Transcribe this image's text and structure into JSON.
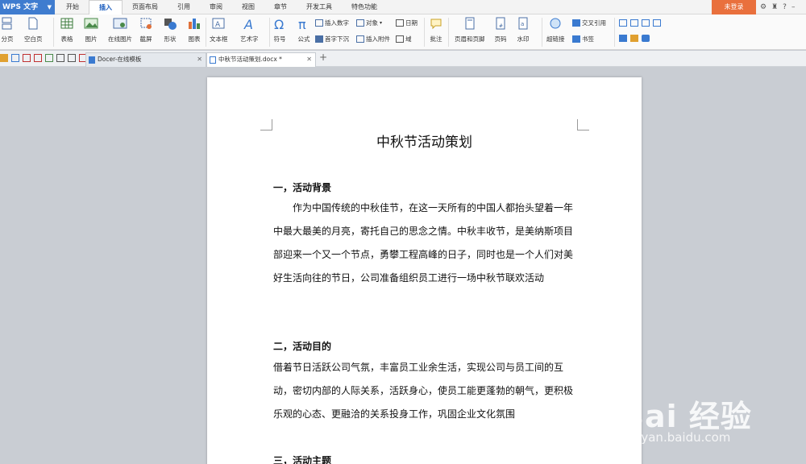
{
  "menubar": {
    "app_label": "WPS 文字",
    "tabs": [
      "开始",
      "插入",
      "页面布局",
      "引用",
      "审阅",
      "视图",
      "章节",
      "开发工具",
      "特色功能"
    ],
    "active_tab": "插入",
    "login_label": "未登录"
  },
  "ribbon": {
    "fenye": "分页",
    "kongbaiye": "空白页",
    "biaoge": "表格",
    "tupian": "图片",
    "zaixian_tupian": "在线图片",
    "jieping": "截屏",
    "xingzhuang": "形状",
    "tubiao": "图表",
    "wenbenkuang": "文本框",
    "yishuzi": "艺术字",
    "fuhao": "符号",
    "gongshi": "公式",
    "charu_shuzi": "插入数字",
    "duixiang": "对象",
    "riqi": "日期",
    "shouzi_xiachen": "首字下沉",
    "charu_fujian": "插入附件",
    "yu": "域",
    "pizhu": "批注",
    "yemei_yejiao": "页眉和页脚",
    "yema": "页码",
    "shuiyin": "水印",
    "chaolianjie": "超链接",
    "jiaocha_yinyong": "交叉引用",
    "shuqian": "书签"
  },
  "doc_tabs": {
    "tab1": "Docer-在线模板",
    "tab2": "中秋节活动策划.docx *"
  },
  "document": {
    "title": "中秋节活动策划",
    "h1": "一，活动背景",
    "p1": "作为中国传统的中秋佳节，在这一天所有的中国人都抬头望着一年中最大最美的月亮，寄托自己的思念之情。中秋丰收节，是美纳斯项目部迎来一个又一个节点，勇攀工程高峰的日子，同时也是一个人们对美好生活向往的节日，公司准备组织员工进行一场中秋节联欢活动",
    "h2": "二，活动目的",
    "p2": "借着节日活跃公司气氛，丰富员工业余生活，实现公司与员工间的互动，密切内部的人际关系，活跃身心，使员工能更蓬勃的朝气，更积极乐观的心态、更融洽的关系投身工作，巩固企业文化氛围",
    "h3": "三，活动主题"
  },
  "watermark": {
    "brand": "Bai  经验",
    "url": "jingyan.baidu.com"
  }
}
